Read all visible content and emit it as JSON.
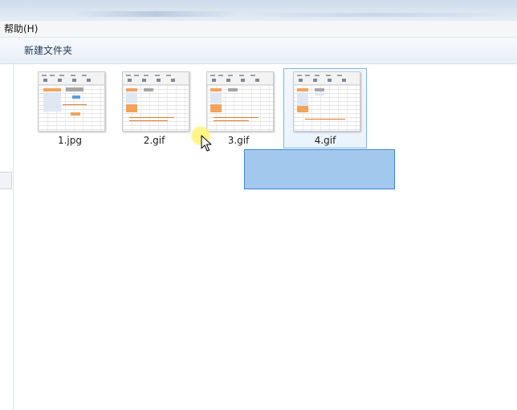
{
  "menubar": {
    "help_label": "帮助(H)"
  },
  "toolbar": {
    "new_folder_label": "新建文件夹"
  },
  "files": [
    {
      "name": "1.jpg",
      "selected": false
    },
    {
      "name": "2.gif",
      "selected": false
    },
    {
      "name": "3.gif",
      "selected": false
    },
    {
      "name": "4.gif",
      "selected": true
    }
  ],
  "colors": {
    "selection_fill": "#60a0e2",
    "selection_border": "#3f86d9",
    "item_selected_border": "#7eb4ea",
    "toolbar_text": "#1e3957"
  },
  "icons": {
    "cursor": "arrow-cursor-icon",
    "click_highlight": "click-highlight-icon"
  }
}
